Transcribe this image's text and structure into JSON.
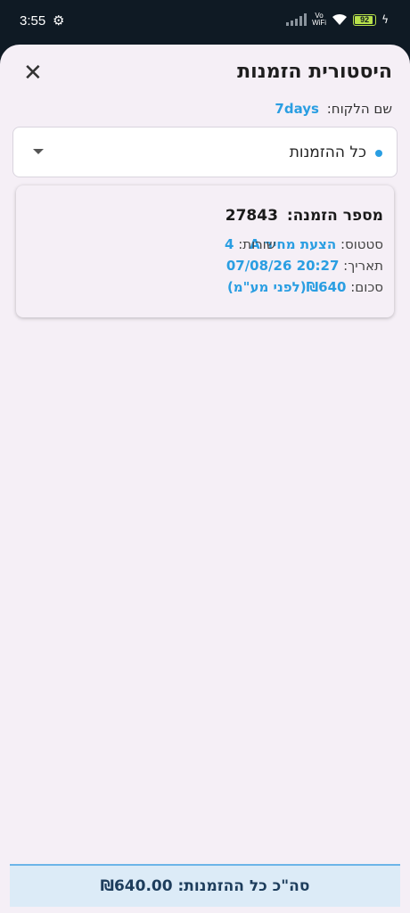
{
  "status_bar": {
    "time": "3:55",
    "settings_icon": "gear-icon",
    "vowifi_top": "Vo",
    "vowifi_bottom": "WiFi",
    "battery": "92",
    "battery_level_percent": 92,
    "colors": {
      "battery": "#b7e04a"
    }
  },
  "header": {
    "title": "היסטורית הזמנות",
    "close_label": "✕"
  },
  "customer": {
    "label": "שם הלקוח:",
    "value": "7days"
  },
  "filter": {
    "selected": "כל ההזמנות"
  },
  "orders": [
    {
      "title_label": "מספר הזמנה:",
      "number": "27843",
      "status_label": "סטטוס:",
      "status_value": "הצעת מחיר A",
      "lines_label": "שורות:",
      "lines_value": "4",
      "date_label": "תאריך:",
      "date_value": "07/08/26 20:27",
      "sum_label": "סכום:",
      "sum_value": "₪640(לפני מע\"מ)"
    }
  ],
  "footer": {
    "total_text": "סה\"כ כל ההזמנות: ₪640.00"
  },
  "colors": {
    "accent": "#2a9ee2",
    "sheet_bg": "#f5eff6",
    "footer_bg": "#dcebf7"
  }
}
